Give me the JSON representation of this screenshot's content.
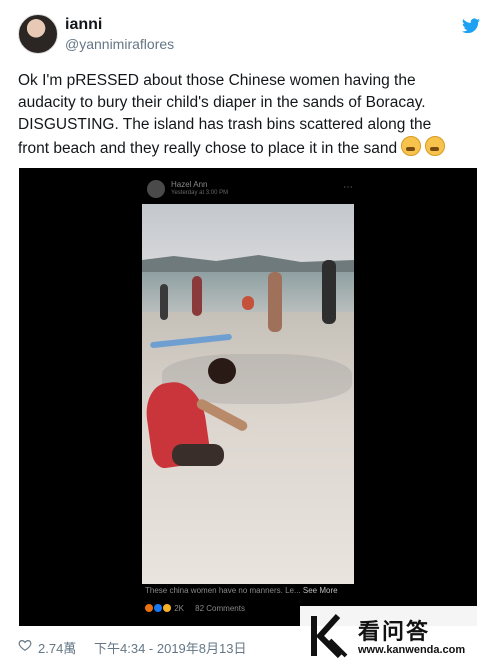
{
  "user": {
    "display_name": "ianni",
    "handle": "@yannimiraflores"
  },
  "tweet": {
    "lines": [
      "Ok I'm pRESSED about those Chinese women having the",
      "audacity to bury their child's diaper in the sands of Boracay.",
      "DISGUSTING. The island has trash bins scattered along the",
      "front beach and they really chose to place it in the sand"
    ],
    "emoji": "tired-face-emoji"
  },
  "media": {
    "poster_name": "Hazel Ann",
    "poster_time": "Yesterday at 3:00 PM",
    "caption": "These china women have no manners. Le...",
    "see_more": "See More",
    "reaction_count": "2K",
    "comment_count": "82 Comments"
  },
  "footer": {
    "likes": "2.74萬",
    "timestamp": "下午4:34 - 2019年8月13日"
  },
  "watermark": {
    "site_name": "看问答",
    "url": "www.kanwenda.com"
  },
  "colors": {
    "twitter_blue": "#1da1f2",
    "text": "#14171a",
    "muted": "#657786"
  }
}
